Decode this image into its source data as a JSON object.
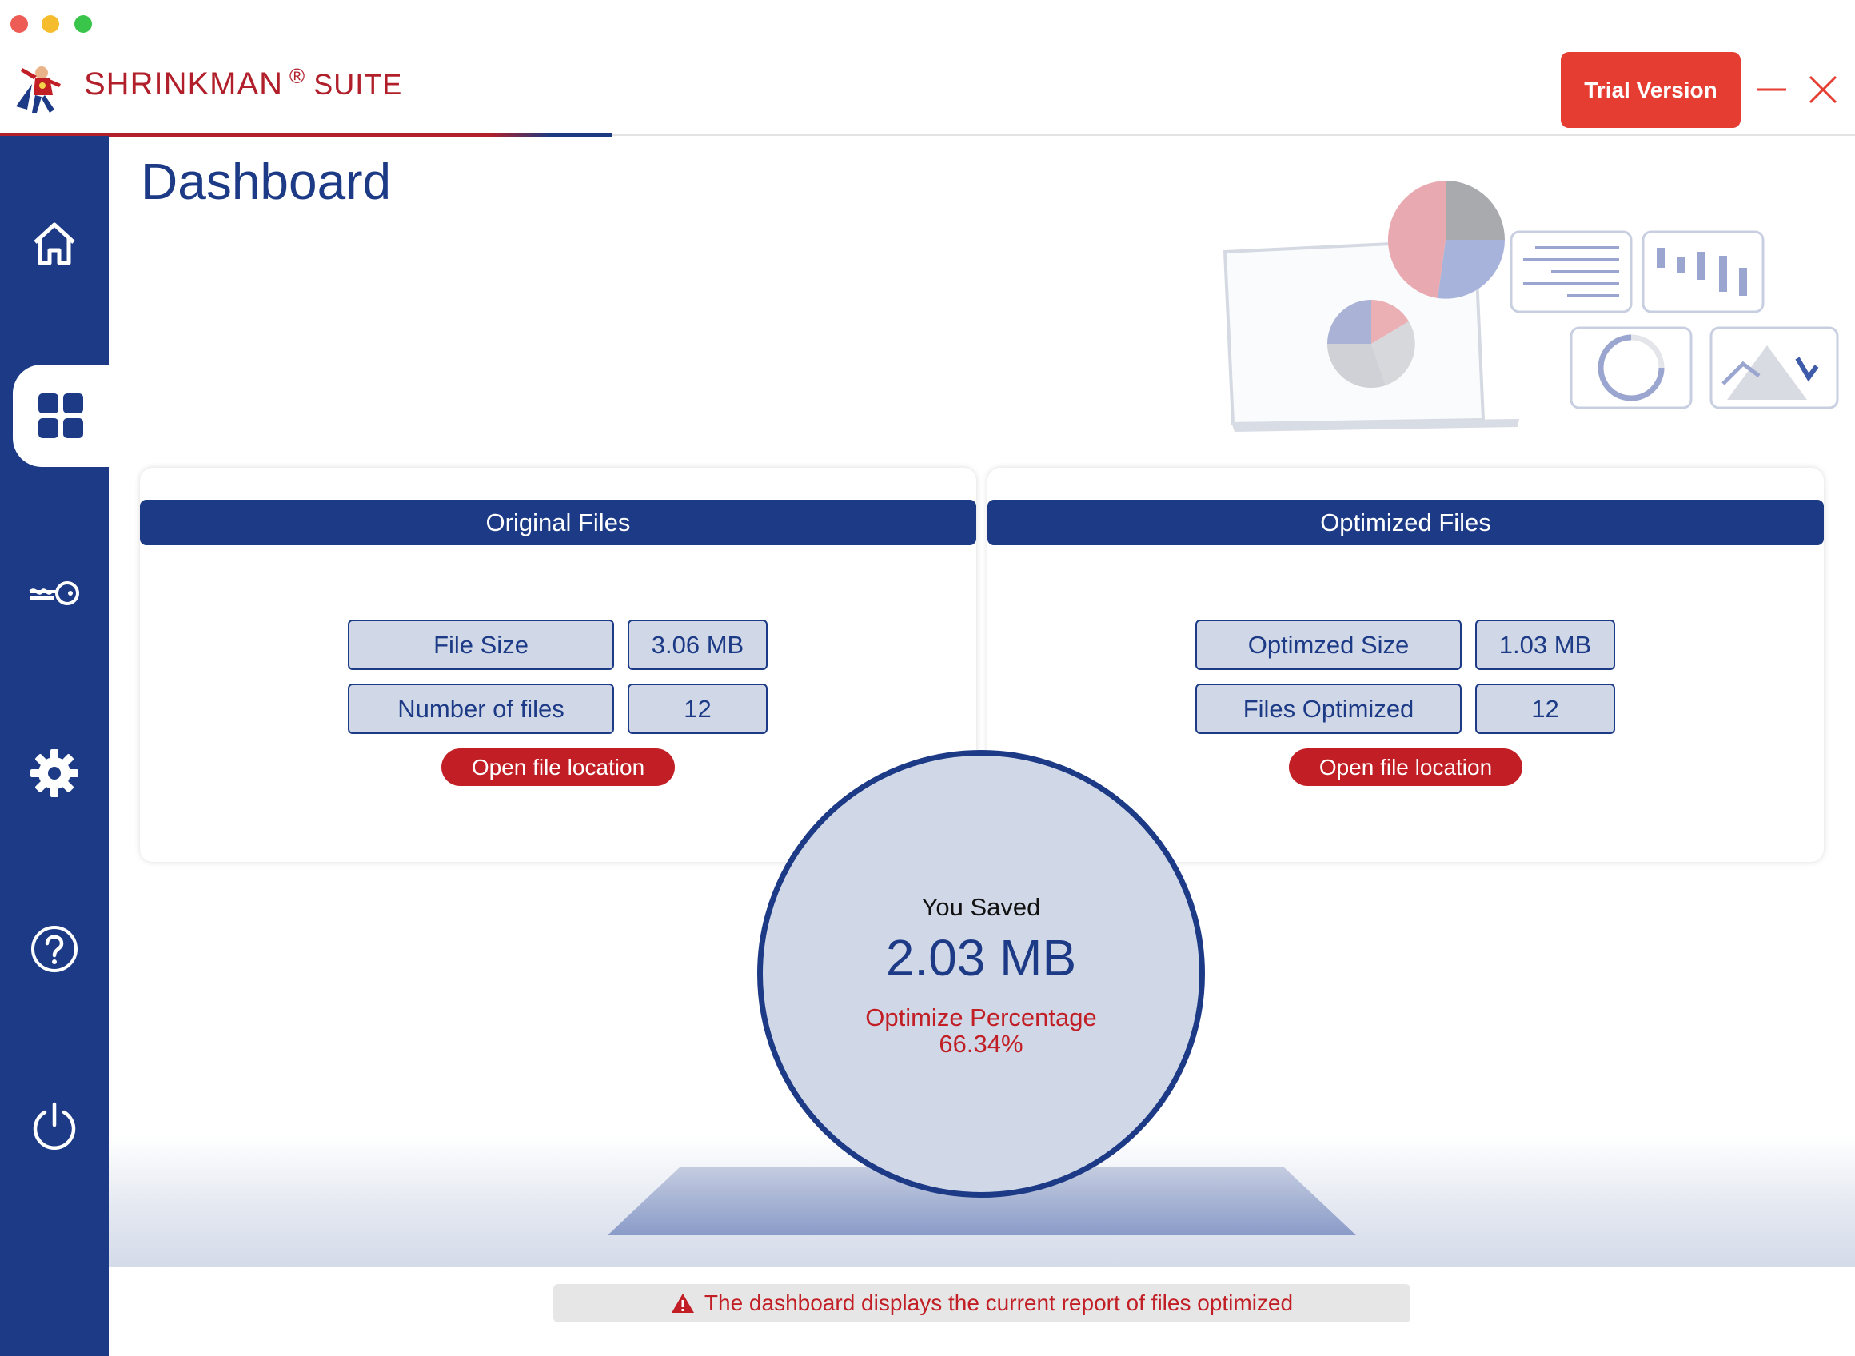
{
  "app": {
    "brand_name": "SHRINKMAN",
    "brand_reg": "®",
    "brand_suite": "SUITE"
  },
  "header": {
    "trial_label": "Trial Version"
  },
  "sidebar": {
    "items": [
      {
        "name": "home",
        "icon": "home-icon"
      },
      {
        "name": "dashboard",
        "icon": "grid-icon",
        "active": true
      },
      {
        "name": "license",
        "icon": "key-icon"
      },
      {
        "name": "settings",
        "icon": "gear-icon"
      },
      {
        "name": "help",
        "icon": "help-icon"
      },
      {
        "name": "power",
        "icon": "power-icon"
      }
    ]
  },
  "page": {
    "title": "Dashboard"
  },
  "original": {
    "header": "Original Files",
    "size_label": "File Size",
    "size_value": "3.06 MB",
    "count_label": "Number of files",
    "count_value": "12",
    "open_label": "Open file location"
  },
  "optimized": {
    "header": "Optimized Files",
    "size_label": "Optimzed Size",
    "size_value": "1.03 MB",
    "count_label": "Files Optimized",
    "count_value": "12",
    "open_label": "Open file location"
  },
  "summary": {
    "saved_label": "You Saved",
    "saved_value": "2.03 MB",
    "percent_label": "Optimize Percentage",
    "percent_value": "66.34%"
  },
  "status": {
    "message": "The dashboard displays the current report of files optimized",
    "icon": "warning-icon"
  },
  "colors": {
    "brand_red": "#b01f2a",
    "primary_blue": "#1c3a85",
    "button_red": "#c11f25",
    "trial_red": "#e53d32",
    "panel_fill": "#d0d8e8"
  }
}
